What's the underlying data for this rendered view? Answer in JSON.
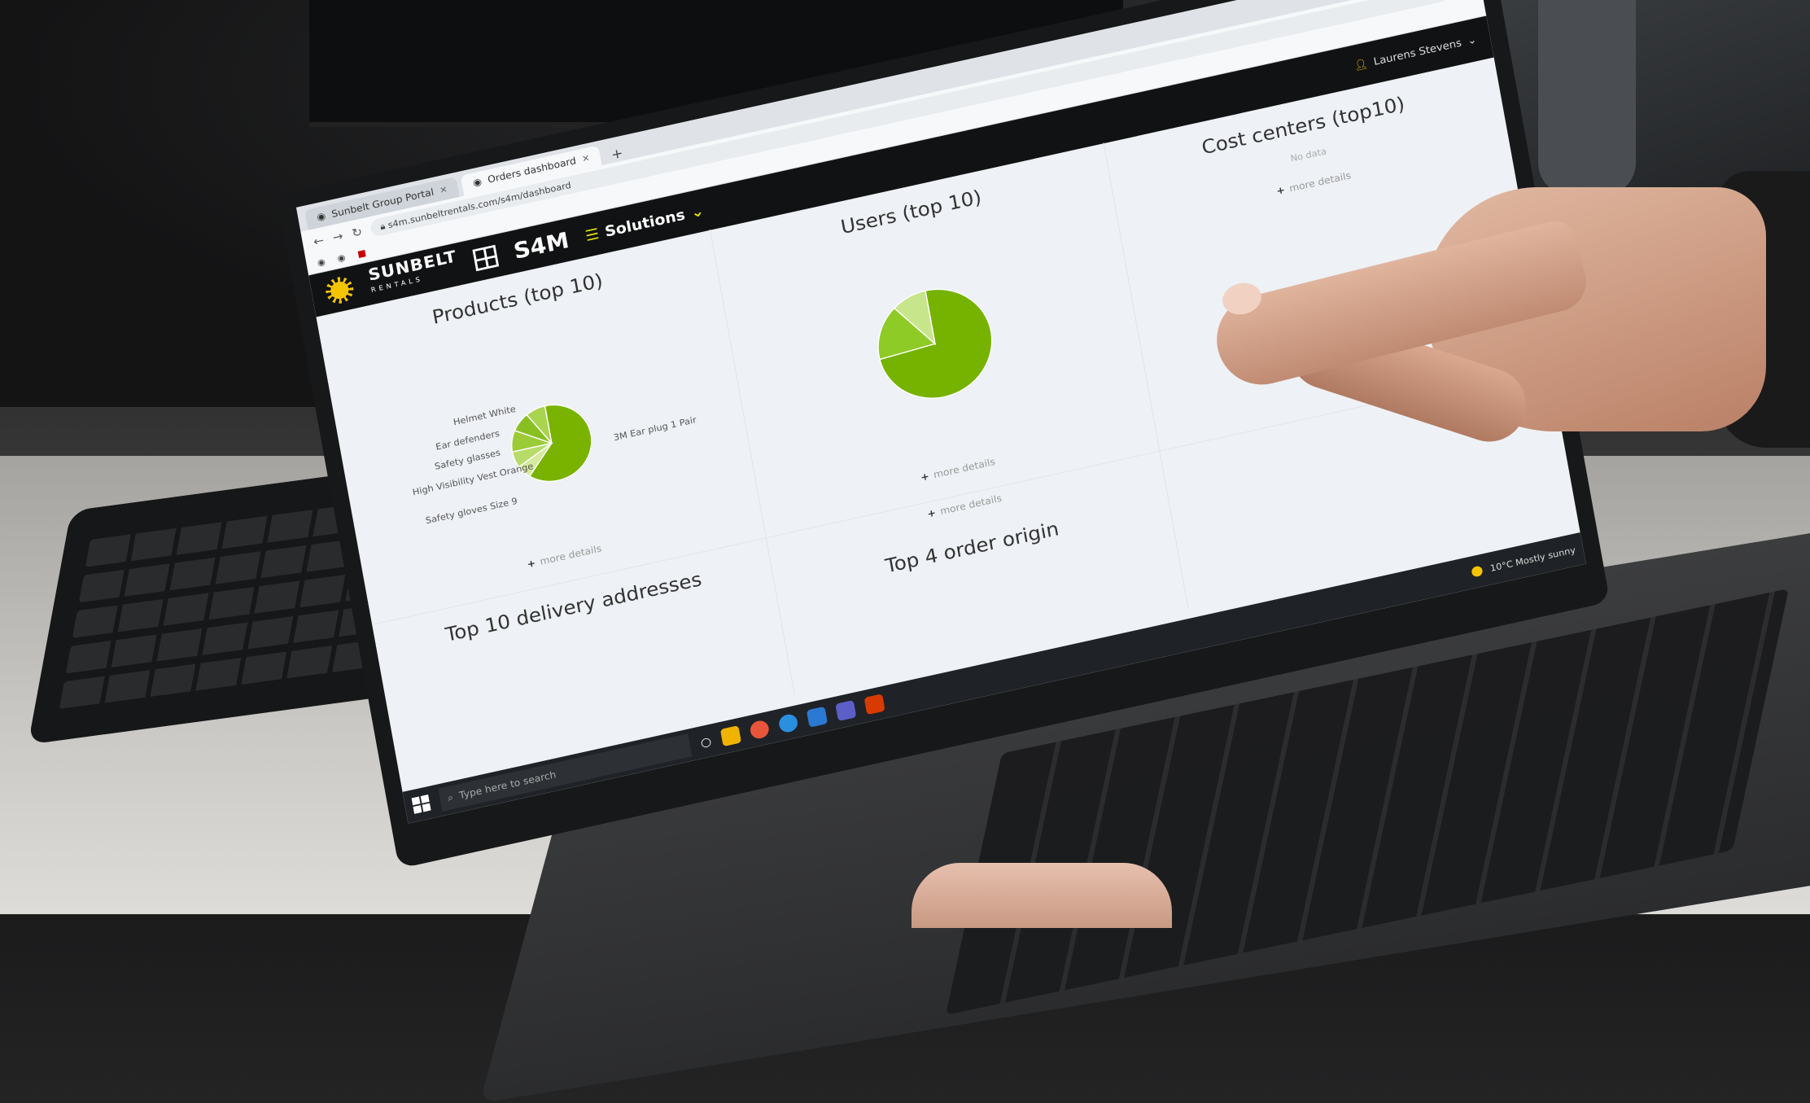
{
  "browser": {
    "tabs": [
      {
        "label": "Sunbelt Group Portal",
        "active": false
      },
      {
        "label": "Orders dashboard",
        "active": true
      }
    ],
    "url": "s4m.sunbeltrentals.com/s4m/dashboard"
  },
  "app": {
    "brand_name": "SUNBELT",
    "brand_sub": "RENTALS",
    "product_logo": "S4M",
    "solutions_label": "Solutions",
    "user_label": "Laurens Stevens"
  },
  "dashboard": {
    "panels": {
      "products": {
        "title": "Products (top 10)",
        "more": "more details",
        "labels": [
          "Helmet White",
          "Ear defenders",
          "Safety glasses",
          "High Visibility Vest Orange",
          "Safety gloves Size 9",
          "3M Ear plug 1 Pair"
        ]
      },
      "users": {
        "title": "Users (top 10)",
        "more": "more details"
      },
      "cost_centers": {
        "title": "Cost centers (top10)",
        "empty": "No data",
        "more": "more details"
      },
      "order_origin": {
        "title": "Top 4 order origin"
      },
      "delivery": {
        "title": "Top 10 delivery addresses"
      }
    },
    "extra_more": "more details"
  },
  "taskbar": {
    "search_placeholder": "Type here to search",
    "weather": "10°C Mostly sunny"
  },
  "chart_data": [
    {
      "type": "pie",
      "title": "Products (top 10)",
      "categories": [
        "3M Ear plug 1 Pair",
        "Helmet White",
        "Ear defenders",
        "Safety glasses",
        "High Visibility Vest Orange",
        "Safety gloves Size 9"
      ],
      "values": [
        62,
        6,
        7,
        9,
        8,
        8
      ],
      "colors": [
        "#79b300",
        "#d5ea9c",
        "#b7dc6a",
        "#9ccb38",
        "#88c021",
        "#a8d450"
      ]
    },
    {
      "type": "pie",
      "title": "Users (top 10)",
      "categories": [
        "",
        "",
        ""
      ],
      "values": [
        74,
        16,
        10
      ],
      "colors": [
        "#75b300",
        "#8fcb26",
        "#c7e58a"
      ]
    }
  ]
}
